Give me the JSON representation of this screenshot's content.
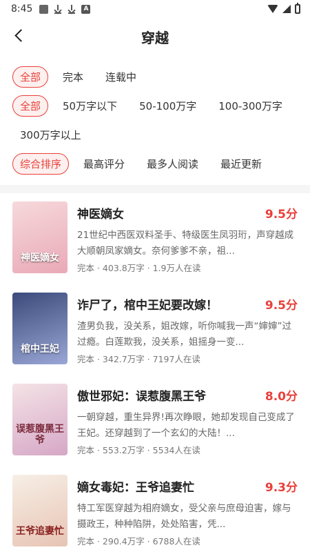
{
  "status": {
    "time": "8:45"
  },
  "header": {
    "title": "穿越"
  },
  "filters": {
    "status": [
      "全部",
      "完本",
      "连载中"
    ],
    "words": [
      "全部",
      "50万字以下",
      "50-100万字",
      "100-300万字"
    ],
    "words_extra": "300万字以上",
    "sort": [
      "综合排序",
      "最高评分",
      "最多人阅读",
      "最近更新"
    ]
  },
  "books": [
    {
      "title": "神医嫡女",
      "score": "9.5分",
      "desc": "21世纪中西医双料圣手、特级医生凤羽珩，声穿越成大顺朝凤家嫡女。奈何爹爹不亲，祖...",
      "meta": "完本 · 403.8万字 · 1.9万人在读",
      "cover_text": "神医嫡女",
      "cover_colors": [
        "#f6d9dc",
        "#e9a9b6"
      ]
    },
    {
      "title": "诈尸了，棺中王妃要改嫁！",
      "score": "9.5分",
      "desc": "渣男负我，没关系，姐改嫁，听你喊我一声“婶婶”过过瘾。白莲欺我，没关系，姐摇身一变...",
      "meta": "完本 · 342.7万字 · 7197人在读",
      "cover_text": "棺中王妃",
      "cover_colors": [
        "#3b4a7a",
        "#9aa7d6"
      ]
    },
    {
      "title": "傲世邪妃：误惹腹黑王爷",
      "score": "8.0分",
      "desc": "一朝穿越，重生异界!再次睁眼，她却发现自己变成了王妃。还穿越到了一个玄幻的大陆！...",
      "meta": "完本 · 553.2万字 · 5534人在读",
      "cover_text": "误惹腹黑王爷",
      "cover_colors": [
        "#f4e3e6",
        "#d6a7c6"
      ]
    },
    {
      "title": "嫡女毒妃：王爷追妻忙",
      "score": "9.3分",
      "desc": "特工军医穿越为相府嫡女，受父亲与庶母迫害，嫁与摄政王，种种陷阱，处处陷害，凭...",
      "meta": "完本 · 290.4万字 · 6788人在读",
      "cover_text": "王爷追妻忙",
      "cover_colors": [
        "#f7efe6",
        "#e7c4b4"
      ]
    }
  ]
}
